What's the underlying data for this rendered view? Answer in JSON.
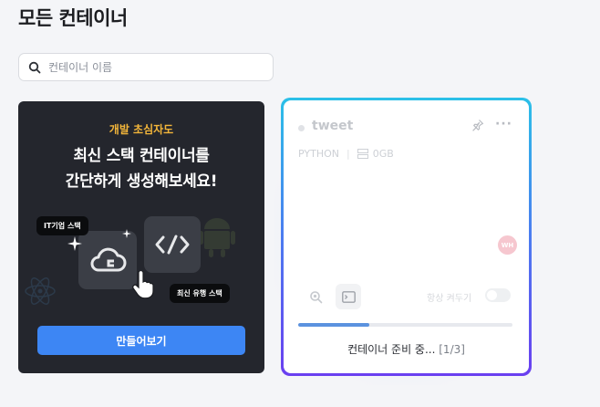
{
  "page": {
    "title": "모든 컨테이너"
  },
  "search": {
    "placeholder": "컨테이너 이름"
  },
  "promo": {
    "subtitle": "개발 초심자도",
    "title_line1": "최신 스택 컨테이너를",
    "title_line2": "간단하게 생성해보세요!",
    "tag1": "IT기업 스택",
    "tag2": "최신 유행 스택",
    "button_label": "만들어보기",
    "accent_color": "#f2b53a",
    "button_color": "#3d86f4"
  },
  "container": {
    "name": "tweet",
    "stack": "PYTHON",
    "storage": "0GB",
    "avatar_initials": "WH",
    "keep_on_label": "항상 켜두기",
    "keep_on": false,
    "progress": 0.33,
    "status_text": "컨테이너 준비 중...",
    "status_step": "[1/3]",
    "border_gradient": [
      "#2bc0e8",
      "#4b7cf0",
      "#6a3ff0"
    ]
  }
}
